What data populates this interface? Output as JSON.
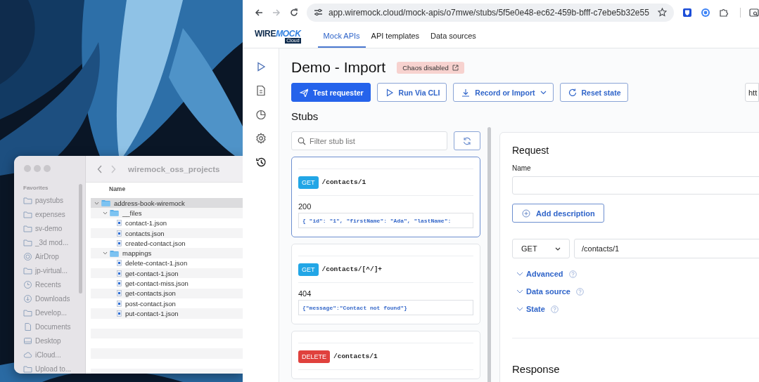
{
  "finder": {
    "title": "wiremock_oss_projects",
    "sidebar": {
      "heading": "Favorites",
      "items": [
        {
          "label": "paystubs",
          "kind": "folder"
        },
        {
          "label": "expenses",
          "kind": "folder"
        },
        {
          "label": "sv-demo",
          "kind": "folder"
        },
        {
          "label": "_3d mod...",
          "kind": "folder"
        },
        {
          "label": "AirDrop",
          "kind": "airdrop"
        },
        {
          "label": "jp-virtual...",
          "kind": "folder"
        },
        {
          "label": "Recents",
          "kind": "clock"
        },
        {
          "label": "Downloads",
          "kind": "download"
        },
        {
          "label": "Develop...",
          "kind": "folder"
        },
        {
          "label": "Documents",
          "kind": "document"
        },
        {
          "label": "Desktop",
          "kind": "desktop"
        },
        {
          "label": "iCloud...",
          "kind": "cloud"
        },
        {
          "label": "Upload to...",
          "kind": "folder"
        }
      ]
    },
    "column": "Name",
    "tree": [
      {
        "name": "address-book-wiremock",
        "kind": "folder",
        "expanded": true,
        "selected": true,
        "children": [
          {
            "name": "__files",
            "kind": "folder",
            "expanded": true,
            "selected": false,
            "children": [
              {
                "name": "contact-1.json",
                "kind": "file",
                "selected": false
              },
              {
                "name": "contacts.json",
                "kind": "file",
                "selected": false
              },
              {
                "name": "created-contact.json",
                "kind": "file",
                "selected": false
              }
            ]
          },
          {
            "name": "mappings",
            "kind": "folder",
            "expanded": true,
            "selected": false,
            "children": [
              {
                "name": "delete-contact-1.json",
                "kind": "file",
                "selected": false
              },
              {
                "name": "get-contact-1.json",
                "kind": "file",
                "selected": false
              },
              {
                "name": "get-contact-miss.json",
                "kind": "file",
                "selected": false
              },
              {
                "name": "get-contacts.json",
                "kind": "file",
                "selected": false
              },
              {
                "name": "post-contact.json",
                "kind": "file",
                "selected": false
              },
              {
                "name": "put-contact-1.json",
                "kind": "file",
                "selected": false
              }
            ]
          }
        ]
      }
    ]
  },
  "browser": {
    "nav": [
      {
        "kind": "back",
        "disabled": false
      },
      {
        "kind": "forward",
        "disabled": true
      },
      {
        "kind": "reload",
        "disabled": false
      }
    ],
    "url": "app.wiremock.cloud/mock-apis/o7mwe/stubs/5f5e0e48-ec62-459b-bfff-c7ebe5b32e55",
    "extensions": [
      {
        "kind": "shield"
      },
      {
        "kind": "circle"
      },
      {
        "kind": "puzzle"
      },
      {
        "kind": "tabsearch"
      }
    ]
  },
  "app": {
    "logo": {
      "left": "WIRE",
      "right": "MOCK",
      "badge": "Cloud"
    },
    "tabs": [
      {
        "label": "Mock APIs",
        "selected": true
      },
      {
        "label": "API templates",
        "selected": false
      },
      {
        "label": "Data sources",
        "selected": false
      }
    ],
    "rail": [
      {
        "kind": "play"
      },
      {
        "kind": "document"
      },
      {
        "kind": "chart"
      },
      {
        "kind": "settings"
      },
      {
        "kind": "history"
      }
    ],
    "title": "Demo - Import",
    "badge": "Chaos disabled",
    "actions": [
      {
        "label": "Test requester",
        "kind": "primary"
      },
      {
        "label": "Run Via CLI",
        "kind": "outline"
      },
      {
        "label": "Record or Import",
        "kind": "outline",
        "menu": true
      },
      {
        "label": "Reset state",
        "kind": "outline"
      }
    ],
    "url_field": "htt",
    "stubs": {
      "heading": "Stubs",
      "filter_placeholder": "Filter stub list",
      "items": [
        {
          "method": "GET",
          "color": "#22a6e6",
          "path": "/contacts/1",
          "status": "200",
          "body": "{ \"id\": \"1\", \"firstName\": \"Ada\", \"lastName\":",
          "selected": true
        },
        {
          "method": "GET",
          "color": "#22a6e6",
          "path": "/contacts/[^/]+",
          "status": "404",
          "body": "{\"message\":\"Contact not found\"}",
          "selected": false
        },
        {
          "method": "DELETE",
          "color": "#e0413d",
          "path": "/contacts/1",
          "selected": false
        }
      ]
    },
    "request": {
      "heading": "Request",
      "name_label": "Name",
      "add_description": "Add description",
      "method": "GET",
      "path": "/contacts/1",
      "sections": [
        {
          "label": "Advanced",
          "expanded": false
        },
        {
          "label": "Data source",
          "expanded": false
        },
        {
          "label": "State",
          "expanded": false
        }
      ]
    },
    "response": {
      "heading": "Response"
    }
  }
}
